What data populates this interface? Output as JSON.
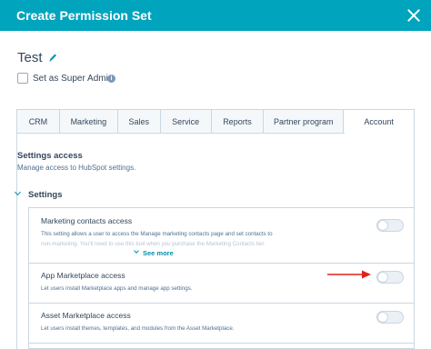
{
  "header": {
    "title": "Create Permission Set"
  },
  "permission_set": {
    "name": "Test"
  },
  "super_admin": {
    "label": "Set as Super Admin",
    "checked": false
  },
  "tabs": [
    {
      "label": "CRM",
      "active": false
    },
    {
      "label": "Marketing",
      "active": false
    },
    {
      "label": "Sales",
      "active": false
    },
    {
      "label": "Service",
      "active": false
    },
    {
      "label": "Reports",
      "active": false
    },
    {
      "label": "Partner program",
      "active": false
    },
    {
      "label": "Account",
      "active": true
    }
  ],
  "settings_access": {
    "title": "Settings access",
    "subtitle": "Manage access to HubSpot settings."
  },
  "settings_group": {
    "label": "Settings",
    "rows": [
      {
        "title": "Marketing contacts access",
        "description_line1": "This setting allows a user to access the Manage marketing contacts page and set contacts to",
        "description_line2": "non-marketing. You'll need to use this tool when you purchase the Marketing Contacts tier.",
        "see_more": "See more",
        "enabled": false
      },
      {
        "title": "App Marketplace access",
        "description_line1": "Let users install Marketplace apps and manage app settings.",
        "enabled": false
      },
      {
        "title": "Asset Marketplace access",
        "description_line1": "Let users install themes, templates, and modules from the Asset Marketplace.",
        "enabled": false
      }
    ]
  },
  "colors": {
    "header_bg": "#00a4bd",
    "link": "#0091ae",
    "text": "#33475b",
    "annotation_arrow": "#e0231b"
  },
  "icons": {
    "close": "close-icon",
    "edit": "pencil-icon",
    "info": "info-icon",
    "expand": "chevron-down-icon"
  }
}
